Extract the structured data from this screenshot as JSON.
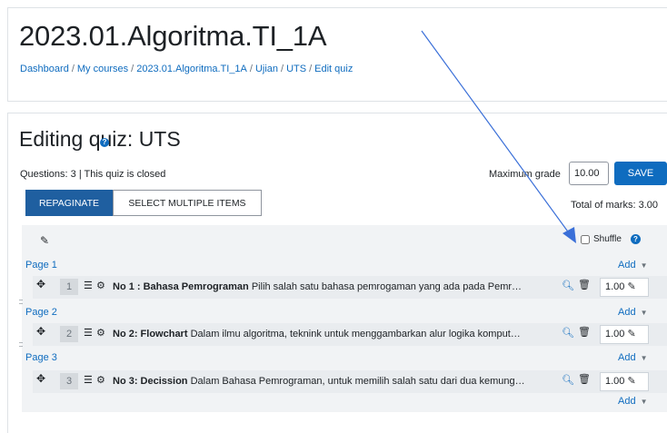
{
  "header": {
    "course_title": "2023.01.Algoritma.TI_1A",
    "breadcrumb": [
      "Dashboard",
      "My courses",
      "2023.01.Algoritma.TI_1A",
      "Ujian",
      "UTS",
      "Edit quiz"
    ]
  },
  "main": {
    "heading": "Editing quiz: UTS",
    "status": "Questions: 3 | This quiz is closed",
    "max_grade_label": "Maximum grade",
    "max_grade_value": "10.00",
    "save_label": "SAVE",
    "repaginate_label": "REPAGINATE",
    "select_multiple_label": "SELECT MULTIPLE ITEMS",
    "total_marks": "Total of marks: 3.00",
    "shuffle_label": "Shuffle",
    "add_label": "Add",
    "pages": [
      {
        "label": "Page 1",
        "question": {
          "number": "1",
          "title": "No 1 : Bahasa Pemrograman",
          "text": "Pilih salah satu bahasa pemrogaman yang ada pada Pemr…",
          "mark": "1.00"
        }
      },
      {
        "label": "Page 2",
        "question": {
          "number": "2",
          "title": "No 2: Flowchart",
          "text": "Dalam ilmu algoritma, teknink untuk menggambarkan alur logika komput…",
          "mark": "1.00"
        }
      },
      {
        "label": "Page 3",
        "question": {
          "number": "3",
          "title": "No 3: Decission",
          "text": "Dalam Bahasa Pemrograman, untuk memilih salah satu dari dua kemung…",
          "mark": "1.00"
        }
      }
    ]
  },
  "icons": {
    "edit": "pencil-icon",
    "move": "move-icon",
    "question_type": "multichoice-icon",
    "settings": "gear-icon",
    "preview": "magnifier-icon",
    "delete": "trash-icon",
    "page_break": "page-break-icon",
    "help": "question-circle-icon"
  },
  "colors": {
    "primary": "#0f6cbf",
    "annotation_arrow": "#3a6fd8"
  }
}
